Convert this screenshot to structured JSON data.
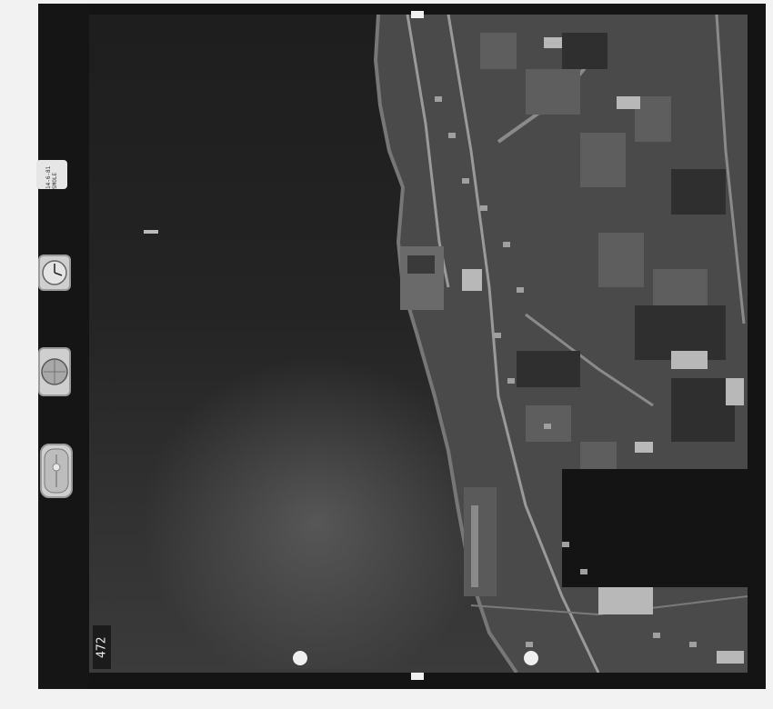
{
  "photo": {
    "frame_number": "472",
    "data_card_text": "14-6-81 SMOLE"
  }
}
